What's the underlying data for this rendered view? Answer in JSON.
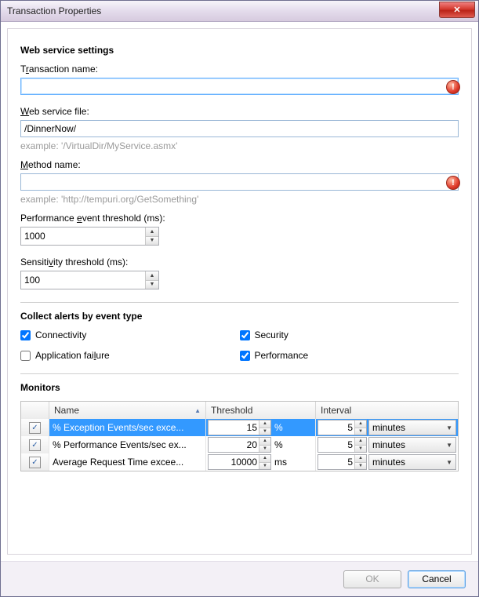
{
  "window": {
    "title": "Transaction Properties",
    "close_glyph": "✕"
  },
  "sections": {
    "web": {
      "title": "Web service settings"
    },
    "alerts": {
      "title": "Collect alerts by event type"
    },
    "monitors": {
      "title": "Monitors"
    }
  },
  "fields": {
    "tx_name": {
      "label_pre": "T",
      "label_u": "r",
      "label_post": "ansaction name:",
      "value": "",
      "error": "!"
    },
    "ws_file": {
      "label_pre": "",
      "label_u": "W",
      "label_post": "eb service file:",
      "value": "/DinnerNow/",
      "hint": "example: '/VirtualDir/MyService.asmx'"
    },
    "method": {
      "label_pre": "",
      "label_u": "M",
      "label_post": "ethod name:",
      "value": "",
      "hint": "example: 'http://tempuri.org/GetSomething'",
      "error": "!"
    },
    "perf": {
      "label_pre": "Performance ",
      "label_u": "e",
      "label_post": "vent threshold (ms):",
      "value": "1000"
    },
    "sens": {
      "label_pre": "Sensiti",
      "label_u": "v",
      "label_post": "ity threshold (ms):",
      "value": "100"
    }
  },
  "alerts": {
    "connectivity": {
      "label": "Connectivity",
      "checked": true
    },
    "security": {
      "label": "Security",
      "checked": true
    },
    "app_failure": {
      "label_pre": "Application fai",
      "label_u": "l",
      "label_post": "ure",
      "checked": false
    },
    "performance": {
      "label": "Performance",
      "checked": true
    }
  },
  "table": {
    "headers": {
      "name": "Name",
      "threshold": "Threshold",
      "interval": "Interval"
    },
    "rows": [
      {
        "checked": true,
        "selected": true,
        "name": "% Exception Events/sec exce...",
        "threshold": "15",
        "unit": "%",
        "interval": "5",
        "interval_unit": "minutes"
      },
      {
        "checked": true,
        "selected": false,
        "name": "% Performance Events/sec ex...",
        "threshold": "20",
        "unit": "%",
        "interval": "5",
        "interval_unit": "minutes"
      },
      {
        "checked": true,
        "selected": false,
        "name": "Average Request Time excee...",
        "threshold": "10000",
        "unit": "ms",
        "interval": "5",
        "interval_unit": "minutes"
      }
    ]
  },
  "footer": {
    "ok": "OK",
    "cancel": "Cancel"
  }
}
